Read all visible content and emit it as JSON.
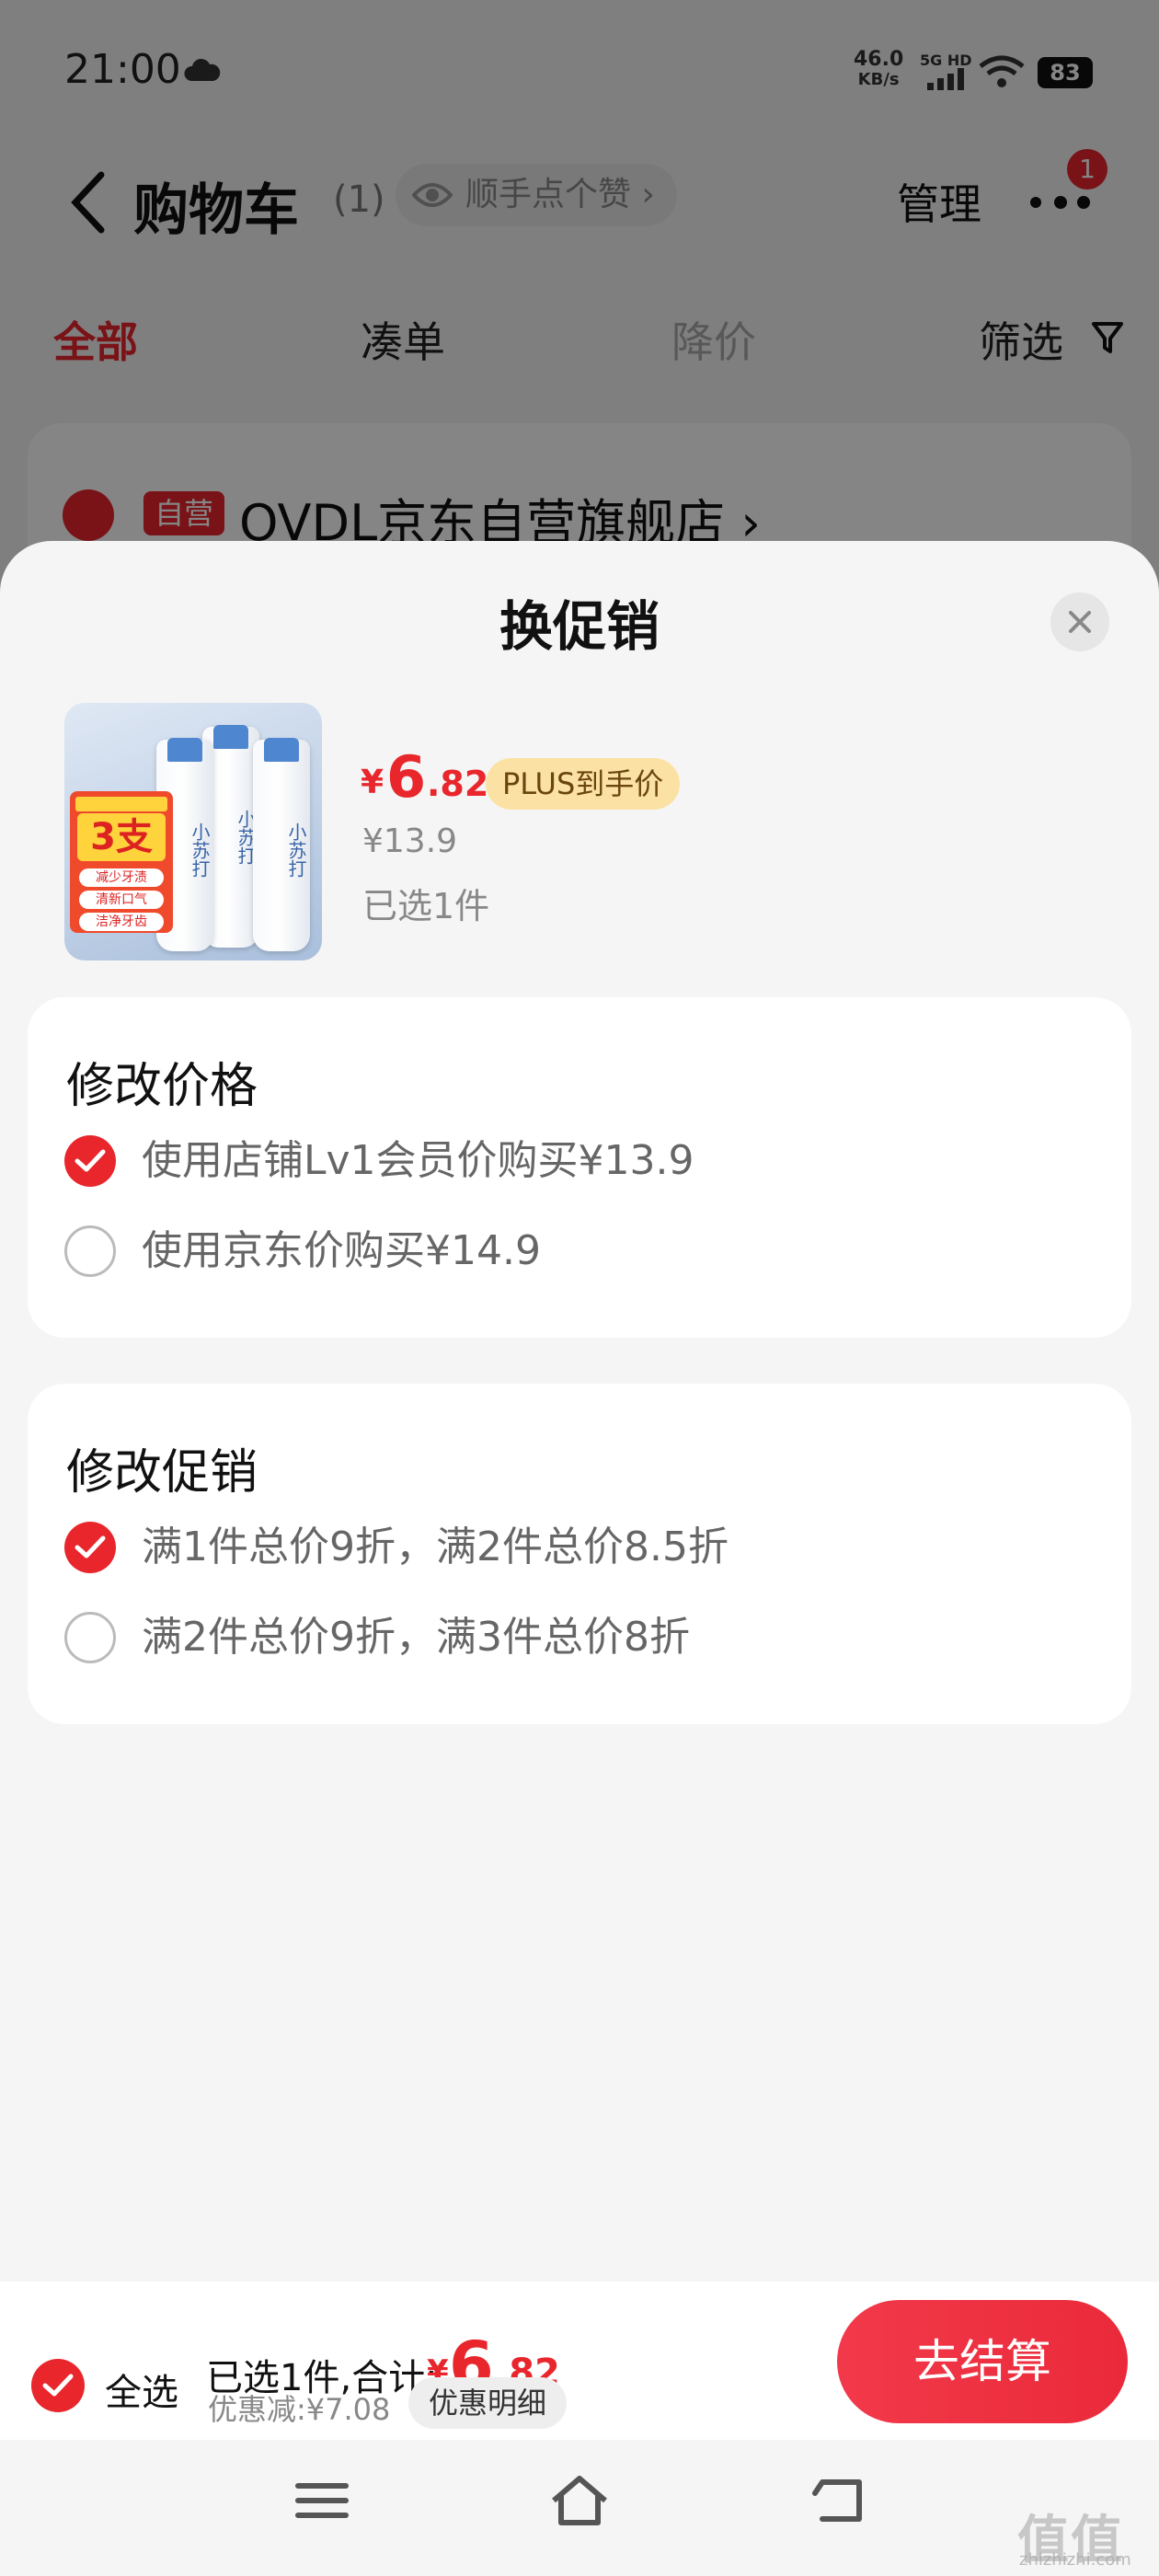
{
  "status_bar": {
    "time": "21:00",
    "net_speed_value": "46.0",
    "net_speed_unit": "KB/s",
    "network_label": "5G HD",
    "battery": "83"
  },
  "nav": {
    "title": "购物车",
    "count": "(1)",
    "like_label": "顺手点个赞",
    "manage_label": "管理",
    "more_badge": "1"
  },
  "filters": {
    "tabs": [
      {
        "label": "全部",
        "state": "active"
      },
      {
        "label": "凑单",
        "state": "normal"
      },
      {
        "label": "降价",
        "state": "disabled"
      }
    ],
    "filter_label": "筛选"
  },
  "store": {
    "tag": "自营",
    "name": "OVDL京东自营旗舰店 ›"
  },
  "sheet": {
    "title": "换促销",
    "product": {
      "image_badge_text": "3支",
      "image_tags": [
        "减少牙渍",
        "清新口气",
        "洁净牙齿"
      ],
      "tube_label": "小苏打",
      "price_currency": "¥",
      "price_int": "6",
      "price_dec": ".82",
      "plus_tag": "PLUS到手价",
      "original_price": "¥13.9",
      "selected_count": "已选1件"
    },
    "price_section": {
      "title": "修改价格",
      "options": [
        {
          "label": "使用店铺Lv1会员价购买¥13.9",
          "selected": true
        },
        {
          "label": "使用京东价购买¥14.9",
          "selected": false
        }
      ]
    },
    "promo_section": {
      "title": "修改促销",
      "options": [
        {
          "label": "满1件总价9折，满2件总价8.5折",
          "selected": true
        },
        {
          "label": "满2件总价9折，满3件总价8折",
          "selected": false
        }
      ]
    }
  },
  "bottom_bar": {
    "select_all_label": "全选",
    "summary_text": "已选1件,合计:",
    "total_currency": "¥",
    "total_int": "6",
    "total_dec": ".82",
    "discount_text": "优惠减:¥7.08",
    "detail_label": "优惠明细",
    "checkout_label": "去结算"
  },
  "watermark": {
    "main": "值值值",
    "sub": "zhizhizhi.com"
  },
  "colors": {
    "accent": "#e8262c",
    "plus_tag_bg": "#fbe2a4",
    "sheet_bg": "#f5f5f5"
  }
}
